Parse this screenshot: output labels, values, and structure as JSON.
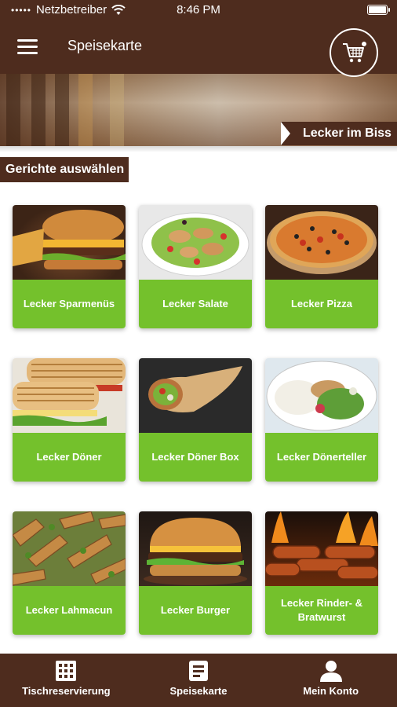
{
  "status_bar": {
    "carrier": "Netzbetreiber",
    "time": "8:46 PM"
  },
  "header": {
    "title": "Speisekarte",
    "cart_icon": "shopping-cart-icon",
    "menu_icon": "hamburger-menu-icon"
  },
  "banner": {
    "tagline": "Lecker im Biss"
  },
  "section": {
    "label": "Gerichte auswählen"
  },
  "categories": [
    {
      "label": "Lecker Sparmenüs"
    },
    {
      "label": "Lecker Salate"
    },
    {
      "label": "Lecker Pizza"
    },
    {
      "label": "Lecker Döner"
    },
    {
      "label": "Lecker Döner Box"
    },
    {
      "label": "Lecker Dönerteller"
    },
    {
      "label": "Lecker Lahmacun"
    },
    {
      "label": "Lecker Burger"
    },
    {
      "label": "Lecker Rinder- & Bratwurst"
    }
  ],
  "bottom_nav": [
    {
      "label": "Tischreservierung",
      "icon": "grid-icon"
    },
    {
      "label": "Speisekarte",
      "icon": "document-icon"
    },
    {
      "label": "Mein Konto",
      "icon": "user-icon"
    }
  ],
  "colors": {
    "brand_brown": "#4e2c1e",
    "accent_green": "#74c12c"
  }
}
